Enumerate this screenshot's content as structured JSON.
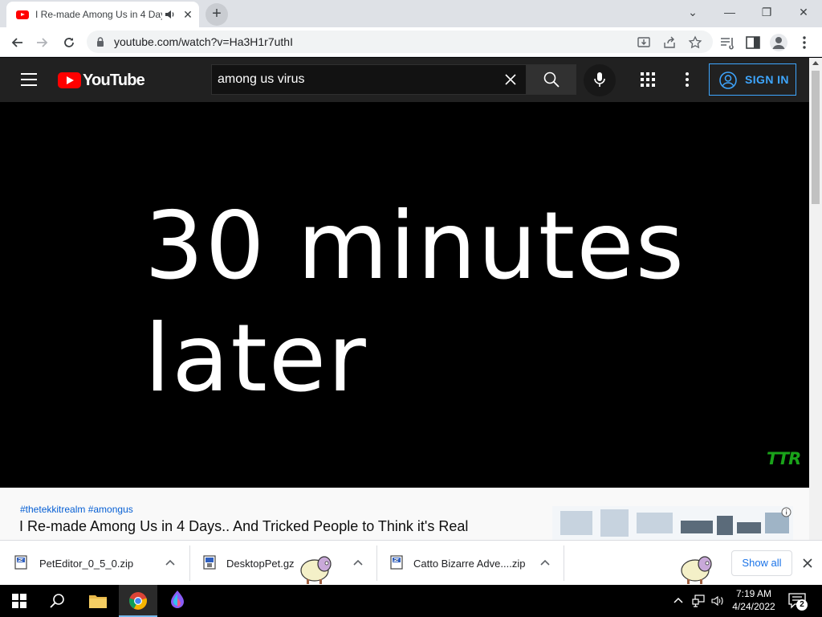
{
  "browser": {
    "tab_title": "I Re-made Among Us in 4 Days.. And Tricked People to Think it's Real",
    "new_tab_label": "+",
    "url": "youtube.com/watch?v=Ha3H1r7uthI",
    "window_controls": {
      "minimize": "—",
      "restore": "❐",
      "close": "✕",
      "dropdown": "⌄"
    }
  },
  "youtube": {
    "logo_text": "YouTube",
    "search_query": "among us virus",
    "signin_label": "SIGN IN"
  },
  "video": {
    "caption": "30 minutes\nlater",
    "watermark": "TTR"
  },
  "below_video": {
    "hashtags": "#thetekkitrealm #amongus",
    "title": "I Re-made Among Us in 4 Days.. And Tricked People to Think it's Real"
  },
  "downloads": {
    "items": [
      {
        "name": "PetEditor_0_5_0.zip"
      },
      {
        "name": "DesktopPet.gz"
      },
      {
        "name": "Catto Bizarre Adve....zip"
      }
    ],
    "show_all_label": "Show all"
  },
  "taskbar": {
    "time": "7:19 AM",
    "date": "4/24/2022",
    "notification_count": "2"
  },
  "colors": {
    "yt_red": "#ff0000",
    "yt_header": "#212121",
    "signin_blue": "#3ea6ff",
    "watermark_green": "#1aa31a",
    "link_blue": "#065fd4"
  }
}
